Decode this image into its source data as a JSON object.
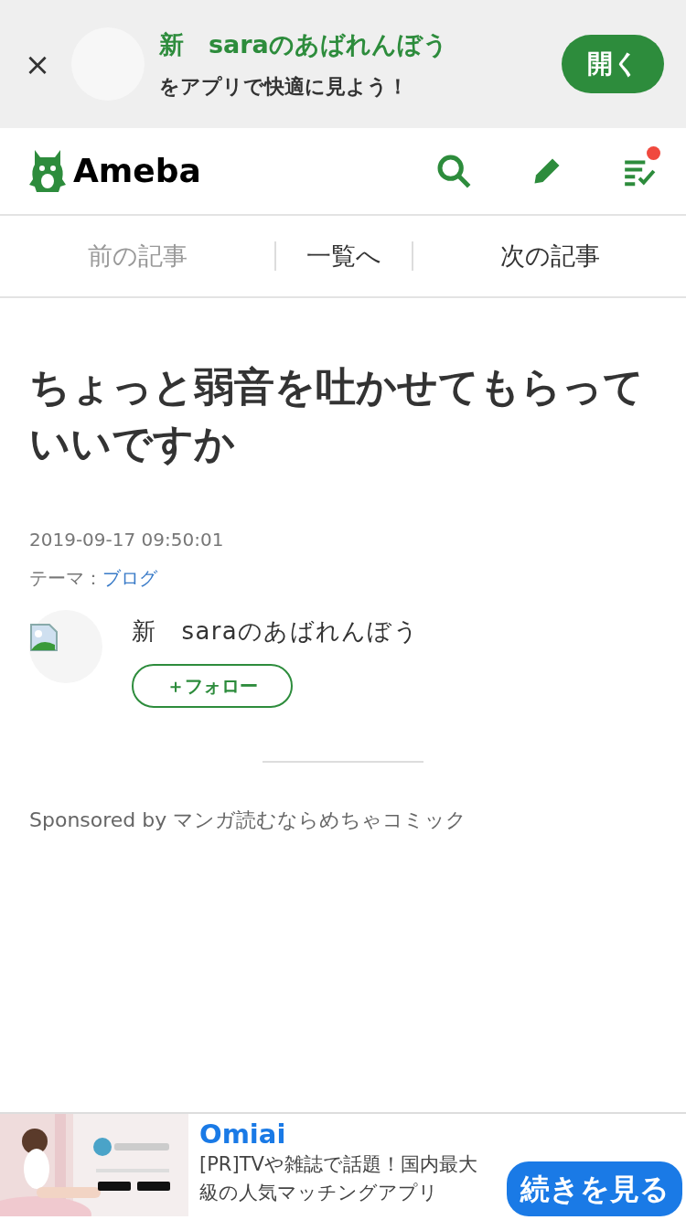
{
  "app_banner": {
    "close": "×",
    "blog_name": "新　saraのあばれんぼう",
    "message": "をアプリで快適に見よう！",
    "open_button": "開く"
  },
  "header": {
    "logo": "Ameba",
    "notification_dot": true
  },
  "article_nav": [
    {
      "label": "前の記事",
      "disabled": true
    },
    {
      "label": "一覧へ",
      "disabled": false
    },
    {
      "label": "次の記事",
      "disabled": false
    }
  ],
  "article": {
    "title": "ちょっと弱音を吐かせてもらっていいですか",
    "date": "2019-09-17 09:50:01",
    "theme_label": "テーマ：",
    "theme": "ブログ",
    "author": "新　saraのあばれんぼう",
    "follow_button": "＋フォロー"
  },
  "sponsored": "Sponsored by マンガ読むならめちゃコミック",
  "bottom_ad": {
    "title": "Omiai",
    "text": "[PR]TVや雑誌で話題！国内最大級の人気マッチングアプリ",
    "button": "続きを見る"
  }
}
